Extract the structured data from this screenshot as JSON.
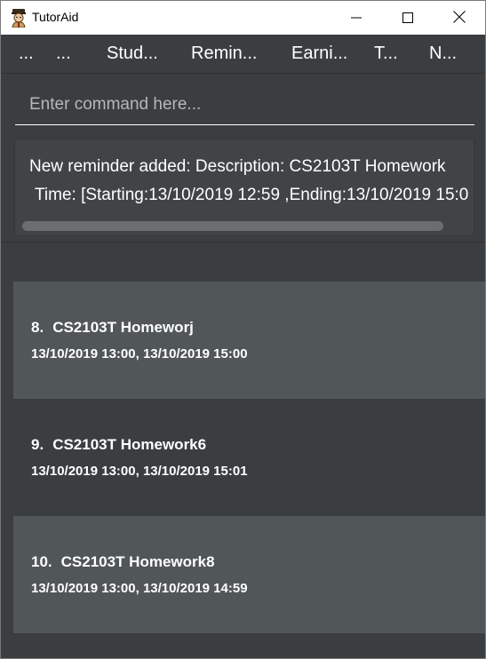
{
  "window": {
    "title": "TutorAid",
    "icons": {
      "app": "student-avatar-icon",
      "minimize": "minimize-icon",
      "maximize": "maximize-icon",
      "close": "close-icon"
    }
  },
  "menu": {
    "items": [
      "...",
      "...",
      "Stud...",
      "Remin...",
      "Earni...",
      "T...",
      "N..."
    ]
  },
  "command": {
    "placeholder": "Enter command here...",
    "value": ""
  },
  "result": {
    "line1": "New reminder added:  Description: CS2103T Homework",
    "line2": "Time: [Starting:13/10/2019 12:59 ,Ending:13/10/2019 15:0"
  },
  "reminders": [
    {
      "index": "8.",
      "description": "CS2103T Homeworj",
      "time": "13/10/2019 13:00, 13/10/2019 15:00"
    },
    {
      "index": "9.",
      "description": "CS2103T Homework6",
      "time": "13/10/2019 13:00, 13/10/2019 15:01"
    },
    {
      "index": "10.",
      "description": "CS2103T Homework8",
      "time": "13/10/2019 13:00, 13/10/2019 14:59"
    }
  ],
  "colors": {
    "background": "#3b3e40",
    "card_alt": "#515658",
    "text": "#ffffff",
    "titlebar": "#ffffff"
  }
}
